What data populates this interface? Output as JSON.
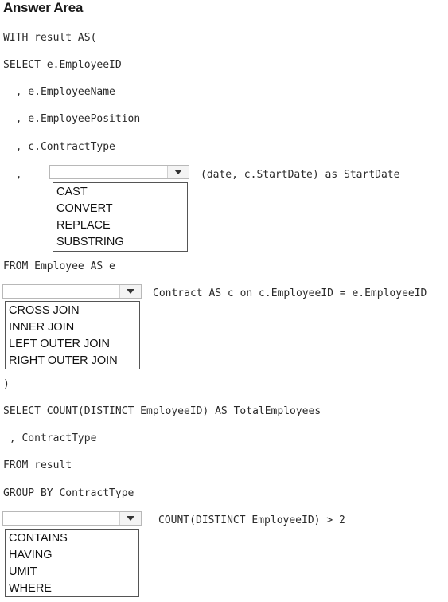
{
  "title": "Answer Area",
  "code_lines": {
    "with": "WITH result AS(",
    "select": "SELECT e.EmployeeID",
    "emp_name": "  , e.EmployeeName",
    "emp_position": "  , e.EmployeePosition",
    "contract_type": "  , c.ContractType",
    "comma": "  ,",
    "start_date_tail": "(date, c.StartDate) as StartDate",
    "from_employee": "FROM Employee AS e",
    "join_tail": "Contract AS c on c.EmployeeID = e.EmployeeID",
    "close_paren": ")",
    "select_count": "SELECT COUNT(DISTINCT EmployeeID) AS TotalEmployees",
    "contract_type2": " , ContractType",
    "from_result": "FROM result",
    "group_by": "GROUP BY ContractType",
    "having_tail": "COUNT(DISTINCT EmployeeID) > 2"
  },
  "dropdown1": {
    "selected": "",
    "options": [
      "CAST",
      "CONVERT",
      "REPLACE",
      "SUBSTRING"
    ]
  },
  "dropdown2": {
    "selected": "",
    "options": [
      "CROSS JOIN",
      "INNER JOIN",
      "LEFT OUTER JOIN",
      "RIGHT OUTER JOIN"
    ]
  },
  "dropdown3": {
    "selected": "",
    "options": [
      "CONTAINS",
      "HAVING",
      "UMIT",
      "WHERE"
    ]
  },
  "icons": {
    "dropdown_arrow": "chevron-down-icon"
  }
}
